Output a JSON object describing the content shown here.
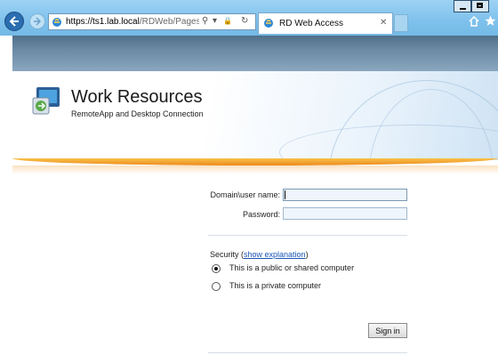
{
  "browser": {
    "url_host": "https://ts1.lab.local",
    "url_path": "/RDWeb/Pages/en-US",
    "tab_title": "RD Web Access",
    "search_glyph": "⚲",
    "dropdown_glyph": "▾",
    "lock_glyph": "🔒",
    "refresh_glyph": "↻",
    "close_glyph": "✕"
  },
  "header": {
    "title": "Work Resources",
    "subtitle": "RemoteApp and Desktop Connection"
  },
  "form": {
    "username_label": "Domain\\user name:",
    "username_value": "",
    "password_label": "Password:",
    "password_value": "",
    "security_prefix": "Security (",
    "security_link": "show explanation",
    "security_suffix": ")",
    "option_public": "This is a public or shared computer",
    "option_private": "This is a private computer",
    "selected_option": "public",
    "signin_label": "Sign in"
  },
  "colors": {
    "accent_orange": "#ec8a1b",
    "link_blue": "#1a56b6",
    "chrome_blue": "#7ec1ec"
  }
}
